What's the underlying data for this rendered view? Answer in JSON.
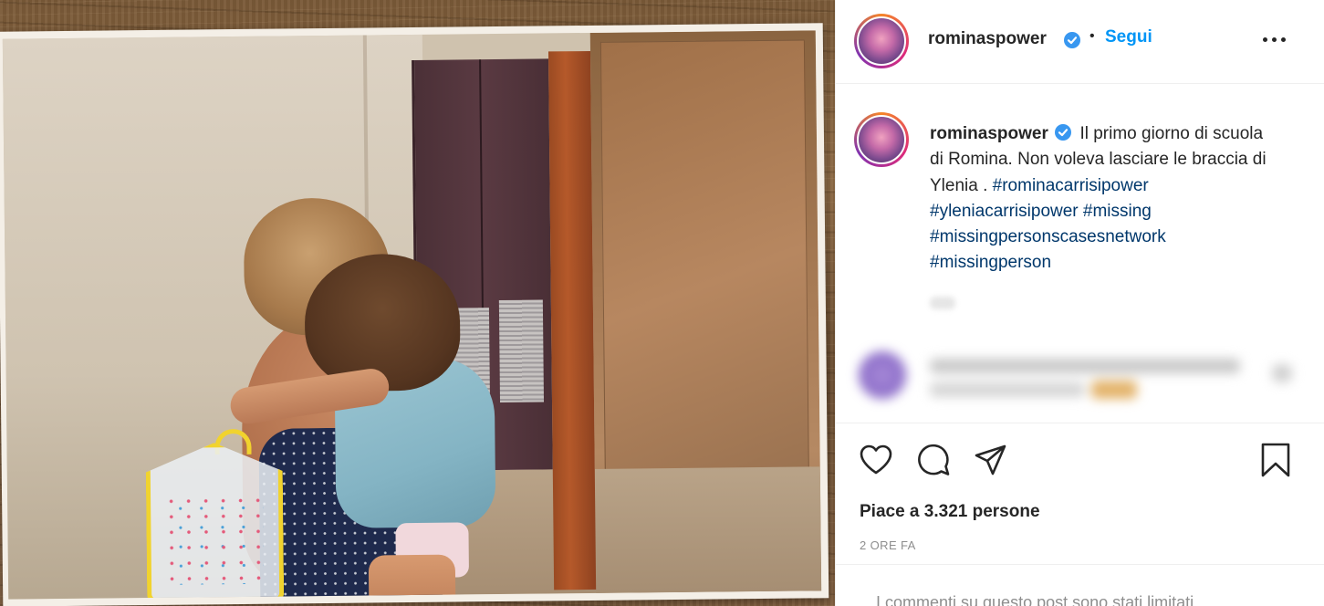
{
  "post": {
    "image_alt": "Vintage photo: a woman in a polka-dot dress hugging a crying child holding a yellow lunchbox"
  },
  "header": {
    "username": "rominaspower",
    "separator": "•",
    "follow_label": "Segui"
  },
  "caption": {
    "username": "rominaspower",
    "text": "Il primo giorno di scuola di Romina. Non voleva lasciare le braccia di Ylenia .",
    "hashtags": [
      "#rominacarrisipower",
      "#yleniacarrisipower",
      "#missing",
      "#missingpersonscasesnetwork",
      "#missingperson"
    ]
  },
  "actions": {
    "like_icon": "heart-icon",
    "comment_icon": "comment-icon",
    "share_icon": "paper-plane-icon",
    "save_icon": "bookmark-icon"
  },
  "likes": {
    "text": "Piace a 3.321 persone"
  },
  "timestamp": "2 ORE FA",
  "footer": {
    "notice": "I commenti su questo post sono stati limitati."
  },
  "colors": {
    "accent": "#0095f6",
    "verified": "#3897f0",
    "hashtag": "#00376b",
    "muted": "#8e8e8e"
  }
}
